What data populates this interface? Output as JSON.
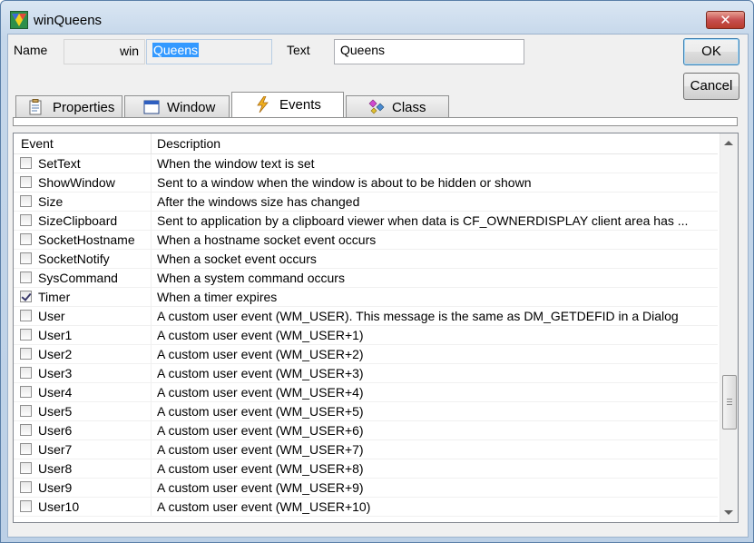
{
  "window": {
    "title": "winQueens",
    "close_glyph": "✕"
  },
  "header": {
    "name_label": "Name",
    "name_prefix": "win",
    "name_value": "Queens",
    "text_label": "Text",
    "text_value": "Queens"
  },
  "buttons": {
    "ok": "OK",
    "cancel": "Cancel"
  },
  "tabs": [
    {
      "label": "Properties",
      "icon": "properties-icon",
      "active": false
    },
    {
      "label": "Window",
      "icon": "window-icon",
      "active": false
    },
    {
      "label": "Events",
      "icon": "lightning-icon",
      "active": true
    },
    {
      "label": "Class",
      "icon": "class-icon",
      "active": false
    }
  ],
  "list": {
    "columns": [
      "Event",
      "Description"
    ],
    "rows": [
      {
        "event": "SetText",
        "desc": "When the window text is set",
        "checked": false
      },
      {
        "event": "ShowWindow",
        "desc": "Sent to a window when the window is about to be hidden or shown",
        "checked": false
      },
      {
        "event": "Size",
        "desc": "After the windows size has changed",
        "checked": false
      },
      {
        "event": "SizeClipboard",
        "desc": "Sent to application by a clipboard viewer when data is CF_OWNERDISPLAY client area has ...",
        "checked": false
      },
      {
        "event": "SocketHostname",
        "desc": "When a hostname socket event occurs",
        "checked": false
      },
      {
        "event": "SocketNotify",
        "desc": "When a socket event occurs",
        "checked": false
      },
      {
        "event": "SysCommand",
        "desc": "When a system command occurs",
        "checked": false
      },
      {
        "event": "Timer",
        "desc": "When a timer expires",
        "checked": true
      },
      {
        "event": "User",
        "desc": "A custom user event (WM_USER).  This message is the same as DM_GETDEFID in a Dialog",
        "checked": false
      },
      {
        "event": "User1",
        "desc": "A custom user event (WM_USER+1)",
        "checked": false
      },
      {
        "event": "User2",
        "desc": "A custom user event (WM_USER+2)",
        "checked": false
      },
      {
        "event": "User3",
        "desc": "A custom user event (WM_USER+3)",
        "checked": false
      },
      {
        "event": "User4",
        "desc": "A custom user event (WM_USER+4)",
        "checked": false
      },
      {
        "event": "User5",
        "desc": "A custom user event (WM_USER+5)",
        "checked": false
      },
      {
        "event": "User6",
        "desc": "A custom user event (WM_USER+6)",
        "checked": false
      },
      {
        "event": "User7",
        "desc": "A custom user event (WM_USER+7)",
        "checked": false
      },
      {
        "event": "User8",
        "desc": "A custom user event (WM_USER+8)",
        "checked": false
      },
      {
        "event": "User9",
        "desc": "A custom user event (WM_USER+9)",
        "checked": false
      },
      {
        "event": "User10",
        "desc": "A custom user event (WM_USER+10)",
        "checked": false
      }
    ]
  }
}
